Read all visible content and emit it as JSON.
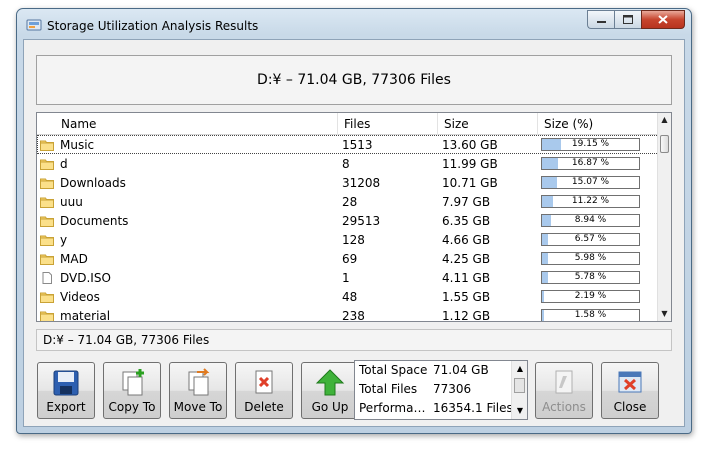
{
  "window": {
    "title": "Storage Utilization Analysis Results"
  },
  "header": {
    "text": "D:¥ – 71.04 GB, 77306 Files"
  },
  "columns": [
    "Name",
    "Files",
    "Size",
    "Size (%)"
  ],
  "rows": [
    {
      "name": "Music",
      "icon": "folder-icon",
      "files": "1513",
      "size": "13.60 GB",
      "pct_label": "19.15 %",
      "pct": 19.15
    },
    {
      "name": "d",
      "icon": "folder-icon",
      "files": "8",
      "size": "11.99 GB",
      "pct_label": "16.87 %",
      "pct": 16.87
    },
    {
      "name": "Downloads",
      "icon": "folder-icon",
      "files": "31208",
      "size": "10.71 GB",
      "pct_label": "15.07 %",
      "pct": 15.07
    },
    {
      "name": "uuu",
      "icon": "folder-icon",
      "files": "28",
      "size": "7.97 GB",
      "pct_label": "11.22 %",
      "pct": 11.22
    },
    {
      "name": "Documents",
      "icon": "folder-icon",
      "files": "29513",
      "size": "6.35 GB",
      "pct_label": "8.94 %",
      "pct": 8.94
    },
    {
      "name": "y",
      "icon": "folder-icon",
      "files": "128",
      "size": "4.66 GB",
      "pct_label": "6.57 %",
      "pct": 6.57
    },
    {
      "name": "MAD",
      "icon": "folder-icon",
      "files": "69",
      "size": "4.25 GB",
      "pct_label": "5.98 %",
      "pct": 5.98
    },
    {
      "name": "DVD.ISO",
      "icon": "file-icon",
      "files": "1",
      "size": "4.11 GB",
      "pct_label": "5.78 %",
      "pct": 5.78
    },
    {
      "name": "Videos",
      "icon": "folder-icon",
      "files": "48",
      "size": "1.55 GB",
      "pct_label": "2.19 %",
      "pct": 2.19
    },
    {
      "name": "material",
      "icon": "folder-icon",
      "files": "238",
      "size": "1.12 GB",
      "pct_label": "1.58 %",
      "pct": 1.58
    }
  ],
  "status": {
    "text": "D:¥ – 71.04 GB, 77306 Files"
  },
  "buttons": {
    "export": "Export",
    "copy_to": "Copy To",
    "move_to": "Move To",
    "delete": "Delete",
    "go_up": "Go Up",
    "actions": "Actions",
    "close": "Close"
  },
  "summary": [
    {
      "key": "Total Space",
      "value": "71.04 GB"
    },
    {
      "key": "Total Files",
      "value": "77306"
    },
    {
      "key": "Performa…",
      "value": "16354.1 Files/"
    }
  ],
  "colors": {
    "bar_fill": "#a9c9ec",
    "window_frame": "#bdd0e2",
    "close_button": "#c7452e"
  }
}
